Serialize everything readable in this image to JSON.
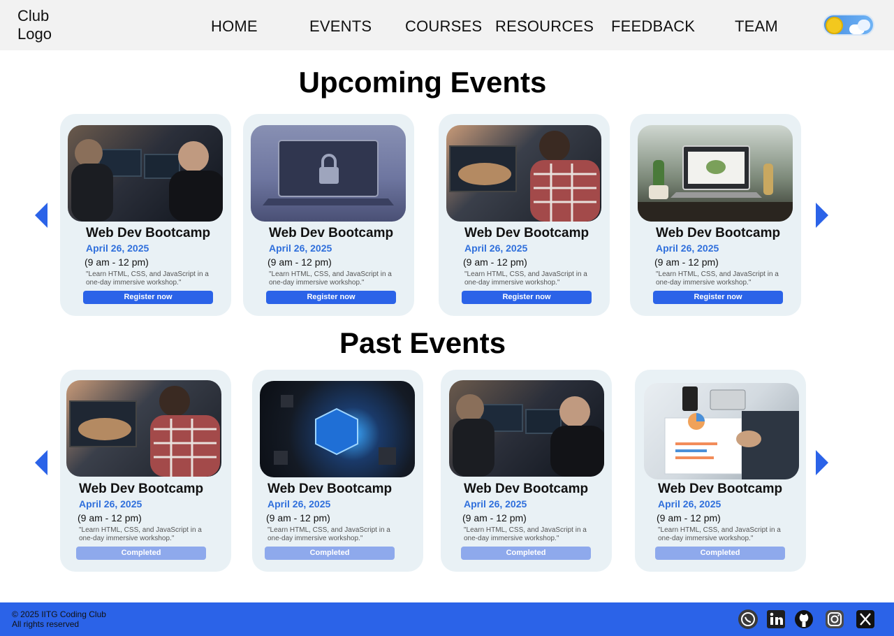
{
  "header": {
    "logo": "Club\nLogo",
    "nav": [
      "HOME",
      "EVENTS",
      "COURSES",
      "RESOURCES",
      "FEEDBACK",
      "TEAM"
    ]
  },
  "upcoming": {
    "title": "Upcoming Events",
    "cards": [
      {
        "title": "Web Dev Bootcamp",
        "date": "April 26, 2025",
        "time": "(9 am - 12 pm)",
        "desc": "\"Learn HTML, CSS, and JavaScript in a one-day immersive workshop.\"",
        "button": "Register now"
      },
      {
        "title": "Web Dev Bootcamp",
        "date": "April 26, 2025",
        "time": "(9 am - 12 pm)",
        "desc": "\"Learn HTML, CSS, and JavaScript in a one-day immersive workshop.\"",
        "button": "Register now"
      },
      {
        "title": "Web Dev Bootcamp",
        "date": "April 26, 2025",
        "time": "(9 am - 12 pm)",
        "desc": "\"Learn HTML, CSS, and JavaScript in a one-day immersive workshop.\"",
        "button": "Register now"
      },
      {
        "title": "Web Dev Bootcamp",
        "date": "April 26, 2025",
        "time": "(9 am - 12 pm)",
        "desc": "\"Learn HTML, CSS, and JavaScript in a one-day immersive workshop.\"",
        "button": "Register now"
      }
    ]
  },
  "past": {
    "title": "Past Events",
    "cards": [
      {
        "title": "Web Dev Bootcamp",
        "date": "April 26, 2025",
        "time": "(9 am - 12 pm)",
        "desc": "\"Learn HTML, CSS, and JavaScript in a one-day immersive workshop.\"",
        "button": "Completed"
      },
      {
        "title": "Web Dev Bootcamp",
        "date": "April 26, 2025",
        "time": "(9 am - 12 pm)",
        "desc": "\"Learn HTML, CSS, and JavaScript in a one-day immersive workshop.\"",
        "button": "Completed"
      },
      {
        "title": "Web Dev Bootcamp",
        "date": "April 26, 2025",
        "time": "(9 am - 12 pm)",
        "desc": "\"Learn HTML, CSS, and JavaScript in a one-day immersive workshop.\"",
        "button": "Completed"
      },
      {
        "title": "Web Dev Bootcamp",
        "date": "April 26, 2025",
        "time": "(9 am - 12 pm)",
        "desc": "\"Learn HTML, CSS, and JavaScript in a one-day immersive workshop.\"",
        "button": "Completed"
      }
    ]
  },
  "footer": {
    "copyright": "© 2025 IITG Coding Club",
    "rights": "All rights reserved",
    "social_icons": [
      "whatsapp-icon",
      "linkedin-icon",
      "github-icon",
      "instagram-icon",
      "x-icon"
    ]
  },
  "colors": {
    "accent": "#2b63e8",
    "date": "#2f6fdc",
    "completed": "#8ea9ec",
    "card_bg": "#e9f1f5"
  }
}
